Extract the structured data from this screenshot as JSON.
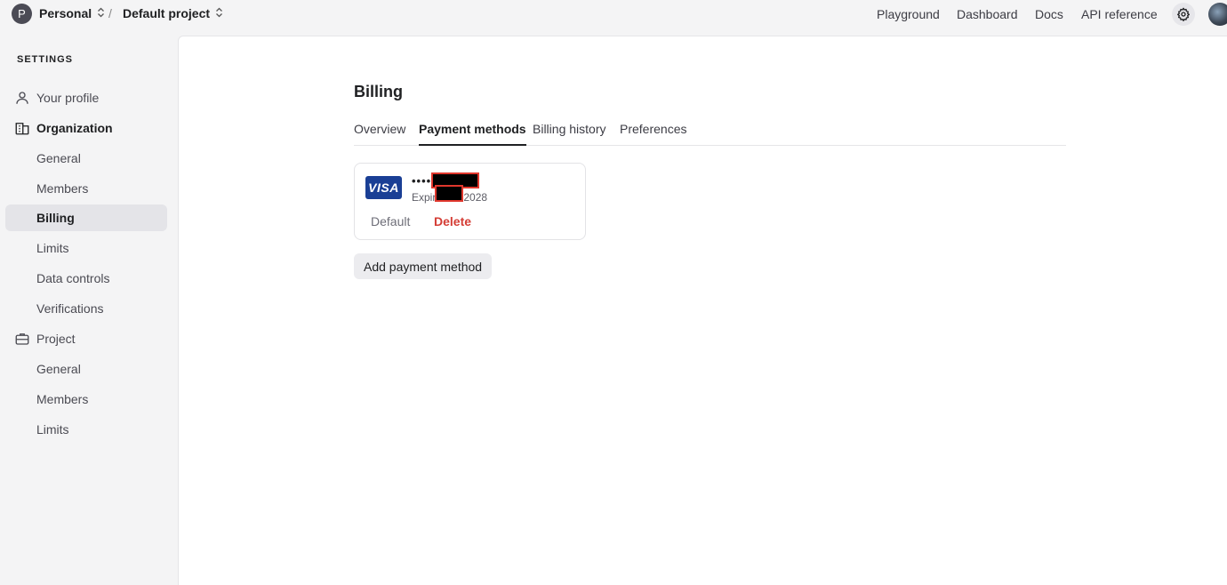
{
  "header": {
    "org_initial": "P",
    "org_name": "Personal",
    "separator": "/",
    "project_name": "Default project",
    "links": [
      "Playground",
      "Dashboard",
      "Docs",
      "API reference"
    ]
  },
  "sidebar": {
    "heading": "SETTINGS",
    "items": [
      {
        "label": "Your profile",
        "icon": "user-icon"
      },
      {
        "label": "Organization",
        "icon": "building-icon"
      },
      {
        "label": "General"
      },
      {
        "label": "Members"
      },
      {
        "label": "Billing"
      },
      {
        "label": "Limits"
      },
      {
        "label": "Data controls"
      },
      {
        "label": "Verifications"
      },
      {
        "label": "Project",
        "icon": "briefcase-icon"
      },
      {
        "label": "General"
      },
      {
        "label": "Members"
      },
      {
        "label": "Limits"
      }
    ]
  },
  "main": {
    "title": "Billing",
    "tabs": [
      "Overview",
      "Payment methods",
      "Billing history",
      "Preferences"
    ],
    "active_tab": "Payment methods",
    "card": {
      "brand": "VISA",
      "number_prefix": "••••",
      "expiry_prefix": "Expir",
      "expiry_suffix": "2028",
      "default_label": "Default",
      "delete_label": "Delete"
    },
    "add_button": "Add payment method"
  },
  "colors": {
    "accent_delete": "#d43d35",
    "visa_blue": "#1a3f95",
    "active_nav_bg": "#e4e4e8"
  }
}
